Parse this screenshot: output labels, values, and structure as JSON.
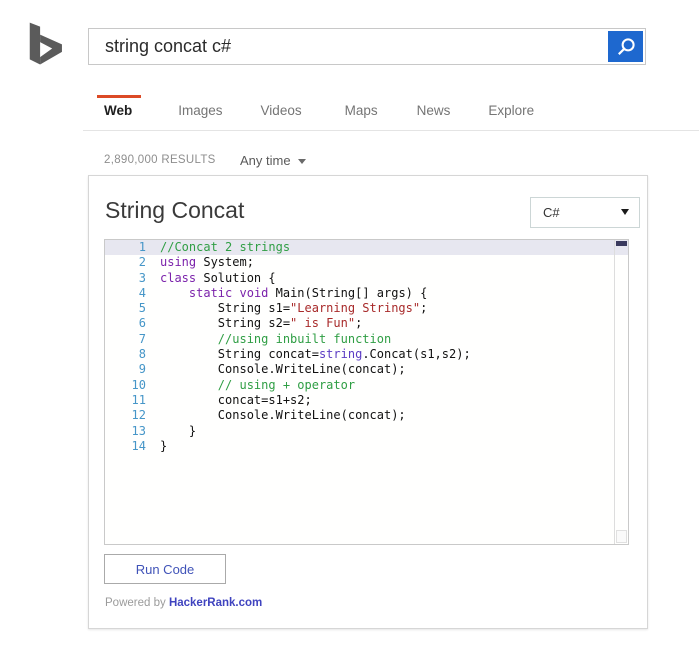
{
  "search": {
    "query": "string concat c#",
    "button_icon": "magnifier"
  },
  "tabs": [
    {
      "label": "Web",
      "active": true
    },
    {
      "label": "Images",
      "active": false
    },
    {
      "label": "Videos",
      "active": false
    },
    {
      "label": "Maps",
      "active": false
    },
    {
      "label": "News",
      "active": false
    },
    {
      "label": "Explore",
      "active": false
    }
  ],
  "results_bar": {
    "count": "2,890,000 RESULTS",
    "time_filter": "Any time"
  },
  "widget": {
    "title": "String Concat",
    "language_selected": "C#",
    "run_label": "Run Code",
    "powered_by": "Powered by",
    "powered_link": "HackerRank.com",
    "code": {
      "lines": [
        {
          "num": 1,
          "highlight": true,
          "tokens": [
            {
              "c": "c",
              "t": "//Concat 2 strings"
            }
          ]
        },
        {
          "num": 2,
          "highlight": false,
          "tokens": [
            {
              "c": "k",
              "t": "using"
            },
            {
              "c": "p",
              "t": " System;"
            }
          ]
        },
        {
          "num": 3,
          "highlight": false,
          "tokens": [
            {
              "c": "k",
              "t": "class"
            },
            {
              "c": "p",
              "t": " Solution {"
            }
          ]
        },
        {
          "num": 4,
          "highlight": false,
          "tokens": [
            {
              "c": "p",
              "t": "    "
            },
            {
              "c": "k",
              "t": "static"
            },
            {
              "c": "p",
              "t": " "
            },
            {
              "c": "k",
              "t": "void"
            },
            {
              "c": "p",
              "t": " Main(String[] args) {"
            }
          ]
        },
        {
          "num": 5,
          "highlight": false,
          "tokens": [
            {
              "c": "p",
              "t": "        String s1="
            },
            {
              "c": "s",
              "t": "\"Learning Strings\""
            },
            {
              "c": "p",
              "t": ";"
            }
          ]
        },
        {
          "num": 6,
          "highlight": false,
          "tokens": [
            {
              "c": "p",
              "t": "        String s2="
            },
            {
              "c": "s",
              "t": "\" is Fun\""
            },
            {
              "c": "p",
              "t": ";"
            }
          ]
        },
        {
          "num": 7,
          "highlight": false,
          "tokens": [
            {
              "c": "p",
              "t": "        "
            },
            {
              "c": "c",
              "t": "//using inbuilt function"
            }
          ]
        },
        {
          "num": 8,
          "highlight": false,
          "tokens": [
            {
              "c": "p",
              "t": "        String concat="
            },
            {
              "c": "k2",
              "t": "string"
            },
            {
              "c": "p",
              "t": ".Concat(s1,s2);"
            }
          ]
        },
        {
          "num": 9,
          "highlight": false,
          "tokens": [
            {
              "c": "p",
              "t": "        Console.WriteLine(concat);"
            }
          ]
        },
        {
          "num": 10,
          "highlight": false,
          "tokens": [
            {
              "c": "p",
              "t": "        "
            },
            {
              "c": "c",
              "t": "// using + operator"
            }
          ]
        },
        {
          "num": 11,
          "highlight": false,
          "tokens": [
            {
              "c": "p",
              "t": "        concat=s1+s2;"
            }
          ]
        },
        {
          "num": 12,
          "highlight": false,
          "tokens": [
            {
              "c": "p",
              "t": "        Console.WriteLine(concat);"
            }
          ]
        },
        {
          "num": 13,
          "highlight": false,
          "tokens": [
            {
              "c": "p",
              "t": "    }"
            }
          ]
        },
        {
          "num": 14,
          "highlight": false,
          "tokens": [
            {
              "c": "p",
              "t": "}"
            }
          ]
        }
      ]
    }
  },
  "colors": {
    "accent_blue": "#1e68cf",
    "tab_bar": "#dc4a26",
    "link_blue": "#3f43bf",
    "run_blue": "#4053b8",
    "syntax_comment": "#2f9e44",
    "syntax_keyword": "#7b22ab",
    "syntax_keyword2": "#5b3cc4",
    "syntax_string": "#a82a2a",
    "line_number": "#4696c8",
    "hl_line": "#e7e7f0",
    "scroll_thumb": "#3a3a5e"
  }
}
